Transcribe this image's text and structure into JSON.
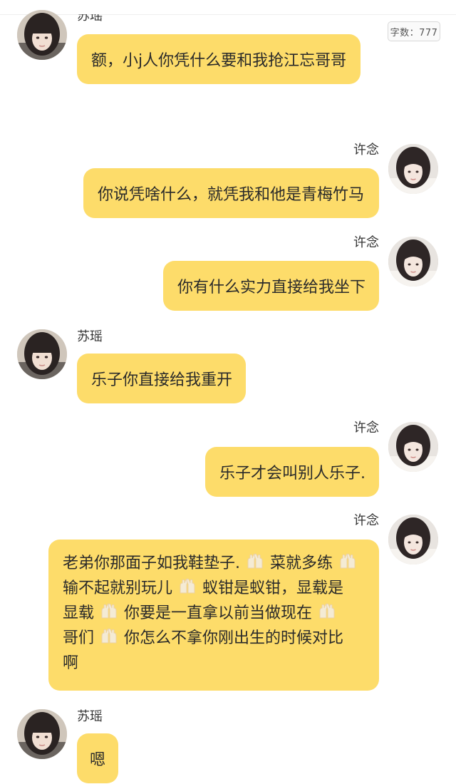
{
  "word_count_label": "字数：777",
  "colors": {
    "bubble": "#fddc6a",
    "background": "#ffffff"
  },
  "messages": [
    {
      "side": "left",
      "sender": "苏瑶",
      "text": "额，小j人你凭什么要和我抢江忘哥哥"
    },
    {
      "side": "right",
      "sender": "许念",
      "text": "你说凭啥什么，就凭我和他是青梅竹马"
    },
    {
      "side": "right",
      "sender": "许念",
      "text": "你有什么实力直接给我坐下"
    },
    {
      "side": "left",
      "sender": "苏瑶",
      "text": "乐子你直接给我重开"
    },
    {
      "side": "right",
      "sender": "许念",
      "text": "乐子才会叫别人乐子."
    },
    {
      "side": "right",
      "sender": "许念",
      "lines": [
        "老弟你那面子如我鞋垫子.",
        "菜就多练",
        "输不起就别玩儿",
        "蚁钳是蚁钳，显载是",
        "显载",
        "你要是一直拿以前当做现在",
        "哥们",
        "你怎么不拿你刚出生的时候对比",
        "啊"
      ],
      "icon": "clapping-hands-icon"
    },
    {
      "side": "left",
      "sender": "苏瑶",
      "text": "嗯"
    }
  ]
}
